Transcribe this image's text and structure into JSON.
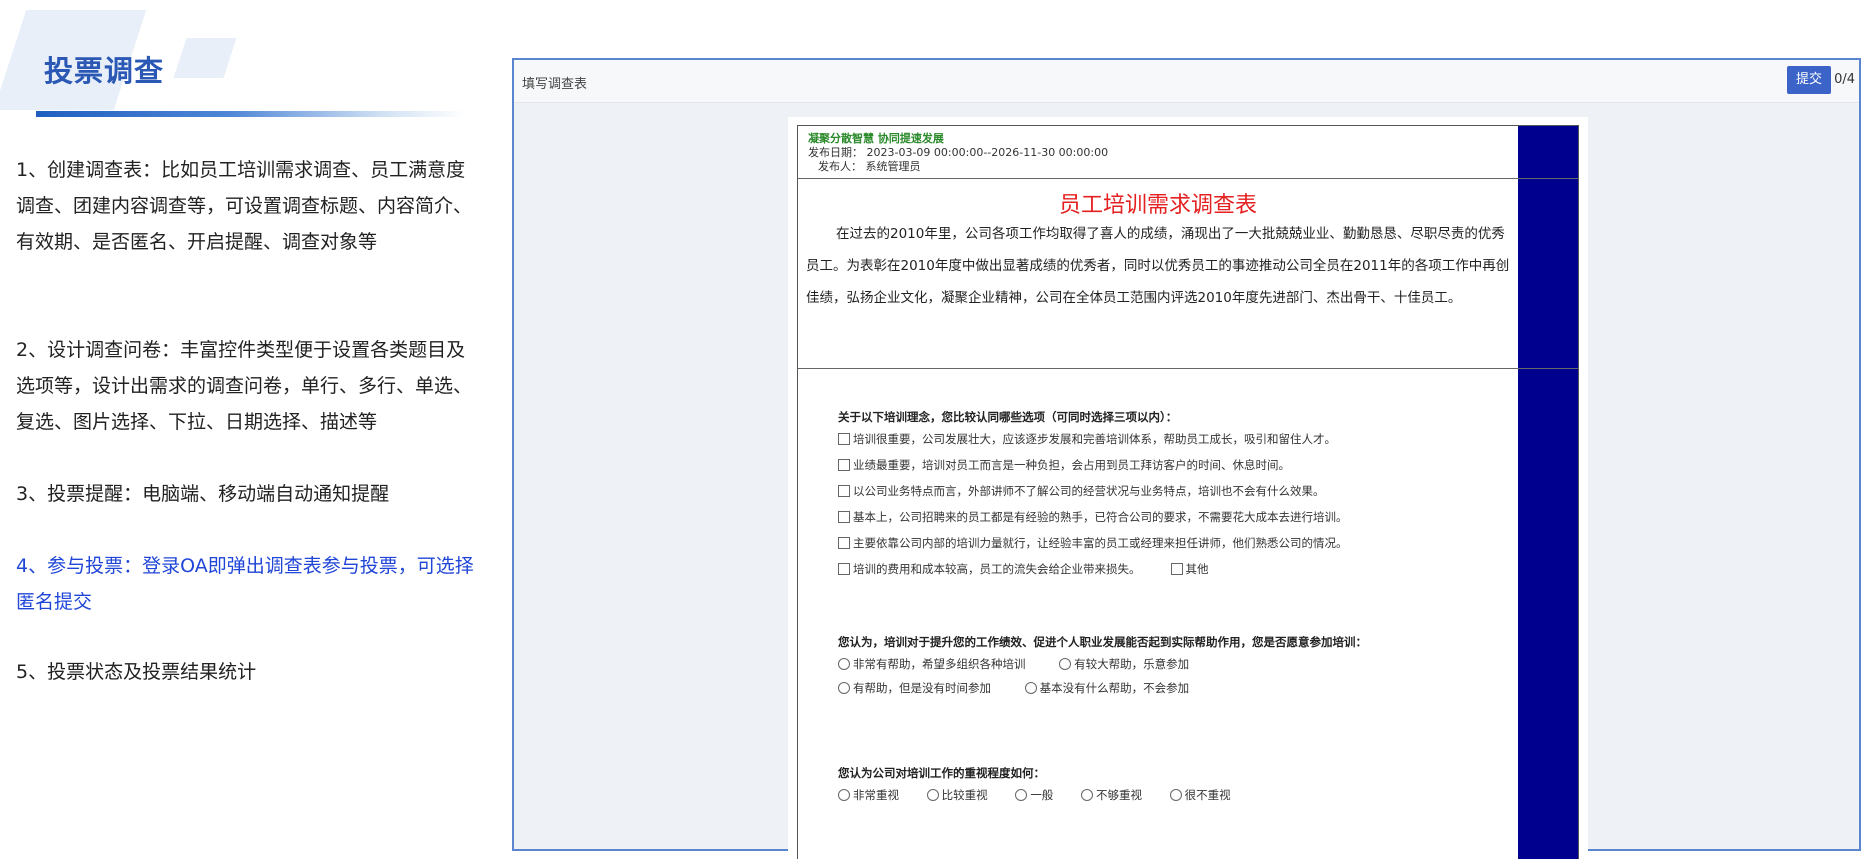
{
  "left_panel": {
    "title": "投票调查",
    "items": [
      "1、创建调查表：比如员工培训需求调查、员工满意度调查、团建内容调查等，可设置调查标题、内容简介、有效期、是否匿名、开启提醒、调查对象等",
      "2、设计调查问卷：丰富控件类型便于设置各类题目及选项等，设计出需求的调查问卷，单行、多行、单选、复选、图片选择、下拉、日期选择、描述等",
      "3、投票提醒：电脑端、移动端自动通知提醒",
      "4、参与投票：登录OA即弹出调查表参与投票，可选择匿名提交",
      "5、投票状态及投票结果统计"
    ],
    "highlight_color": "#2046d8"
  },
  "survey_window": {
    "title": "填写调查表",
    "submit_label": "提交",
    "page_count": "0/4",
    "slogan": "凝聚分散智慧 协同提速发展",
    "publish_date": "发布日期：  2023-03-09 00:00:00--2026-11-30 00:00:00",
    "publisher": "发布人：  系统管理员",
    "survey_title": "员工培训需求调查表",
    "intro": "在过去的2010年里，公司各项工作均取得了喜人的成绩，涌现出了一大批兢兢业业、勤勤恳恳、尽职尽责的优秀员工。为表彰在2010年度中做出显著成绩的优秀者，同时以优秀员工的事迹推动公司全员在2011年的各项工作中再创佳绩，弘扬企业文化，凝聚企业精神，公司在全体员工范围内评选2010年度先进部门、杰出骨干、十佳员工。",
    "q1": {
      "title": "关于以下培训理念，您比较认同哪些选项（可同时选择三项以内）：",
      "options": [
        "培训很重要，公司发展壮大，应该逐步发展和完善培训体系，帮助员工成长，吸引和留住人才。",
        "业绩最重要，培训对员工而言是一种负担，会占用到员工拜访客户的时间、休息时间。",
        "以公司业务特点而言，外部讲师不了解公司的经营状况与业务特点，培训也不会有什么效果。",
        "基本上，公司招聘来的员工都是有经验的熟手，已符合公司的要求，不需要花大成本去进行培训。",
        "主要依靠公司内部的培训力量就行，让经验丰富的员工或经理来担任讲师，他们熟悉公司的情况。",
        "培训的费用和成本较高，员工的流失会给企业带来损失。"
      ],
      "other": "其他"
    },
    "q2": {
      "title": "您认为，培训对于提升您的工作绩效、促进个人职业发展能否起到实际帮助作用，您是否愿意参加培训：",
      "options": [
        "非常有帮助，希望多组织各种培训",
        "有较大帮助，乐意参加",
        "有帮助，但是没有时间参加",
        "基本没有什么帮助，不会参加"
      ]
    },
    "q3": {
      "title": "您认为公司对培训工作的重视程度如何：",
      "options": [
        "非常重视",
        "比较重视",
        "一般",
        "不够重视",
        "很不重视"
      ]
    }
  }
}
